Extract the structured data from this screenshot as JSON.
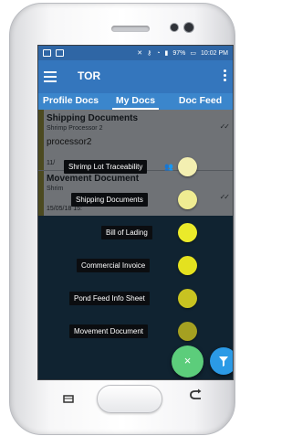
{
  "statusbar": {
    "battery": "97%",
    "time": "10:02 PM"
  },
  "appbar": {
    "title": "TOR"
  },
  "tabs": [
    {
      "label": "Profile Docs",
      "active": false
    },
    {
      "label": "My Docs",
      "active": true
    },
    {
      "label": "Doc Feed",
      "active": false
    }
  ],
  "cards": [
    {
      "title": "Shipping Documents",
      "subtitle": "Shrimp Processor 2",
      "owner": "processor2",
      "date": "11/"
    },
    {
      "title": "Movement Document",
      "subtitle": "Shrim",
      "owner": "",
      "date": "15/05/18 15:"
    }
  ],
  "speed_dial": [
    {
      "label": "Shrimp Lot Traceability",
      "color": "#f3efb1"
    },
    {
      "label": "Shipping Documents",
      "color": "#efec92"
    },
    {
      "label": "Bill of Lading",
      "color": "#ebea2a"
    },
    {
      "label": "Commercial Invoice",
      "color": "#e4e11f"
    },
    {
      "label": "Pond Feed Info Sheet",
      "color": "#c8c321"
    },
    {
      "label": "Movement Document",
      "color": "#a5a021"
    }
  ],
  "fab": {
    "close_symbol": "×",
    "close_color": "#5ccd7b",
    "filter_color": "#2b9ae6"
  },
  "colors": {
    "statusbar": "#2f66a5",
    "appbar": "#3476bd",
    "tabs": "#3b86cc"
  }
}
